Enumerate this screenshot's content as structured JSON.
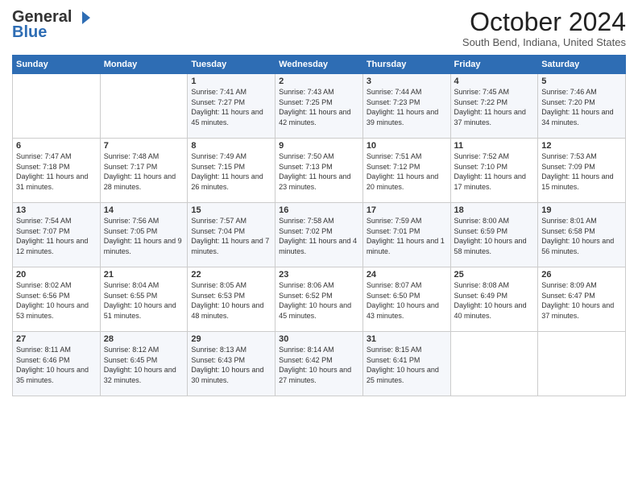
{
  "logo": {
    "line1": "General",
    "line2": "Blue",
    "icon": "▶"
  },
  "title": "October 2024",
  "location": "South Bend, Indiana, United States",
  "days_header": [
    "Sunday",
    "Monday",
    "Tuesday",
    "Wednesday",
    "Thursday",
    "Friday",
    "Saturday"
  ],
  "weeks": [
    [
      {
        "day": "",
        "sunrise": "",
        "sunset": "",
        "daylight": ""
      },
      {
        "day": "",
        "sunrise": "",
        "sunset": "",
        "daylight": ""
      },
      {
        "day": "1",
        "sunrise": "Sunrise: 7:41 AM",
        "sunset": "Sunset: 7:27 PM",
        "daylight": "Daylight: 11 hours and 45 minutes."
      },
      {
        "day": "2",
        "sunrise": "Sunrise: 7:43 AM",
        "sunset": "Sunset: 7:25 PM",
        "daylight": "Daylight: 11 hours and 42 minutes."
      },
      {
        "day": "3",
        "sunrise": "Sunrise: 7:44 AM",
        "sunset": "Sunset: 7:23 PM",
        "daylight": "Daylight: 11 hours and 39 minutes."
      },
      {
        "day": "4",
        "sunrise": "Sunrise: 7:45 AM",
        "sunset": "Sunset: 7:22 PM",
        "daylight": "Daylight: 11 hours and 37 minutes."
      },
      {
        "day": "5",
        "sunrise": "Sunrise: 7:46 AM",
        "sunset": "Sunset: 7:20 PM",
        "daylight": "Daylight: 11 hours and 34 minutes."
      }
    ],
    [
      {
        "day": "6",
        "sunrise": "Sunrise: 7:47 AM",
        "sunset": "Sunset: 7:18 PM",
        "daylight": "Daylight: 11 hours and 31 minutes."
      },
      {
        "day": "7",
        "sunrise": "Sunrise: 7:48 AM",
        "sunset": "Sunset: 7:17 PM",
        "daylight": "Daylight: 11 hours and 28 minutes."
      },
      {
        "day": "8",
        "sunrise": "Sunrise: 7:49 AM",
        "sunset": "Sunset: 7:15 PM",
        "daylight": "Daylight: 11 hours and 26 minutes."
      },
      {
        "day": "9",
        "sunrise": "Sunrise: 7:50 AM",
        "sunset": "Sunset: 7:13 PM",
        "daylight": "Daylight: 11 hours and 23 minutes."
      },
      {
        "day": "10",
        "sunrise": "Sunrise: 7:51 AM",
        "sunset": "Sunset: 7:12 PM",
        "daylight": "Daylight: 11 hours and 20 minutes."
      },
      {
        "day": "11",
        "sunrise": "Sunrise: 7:52 AM",
        "sunset": "Sunset: 7:10 PM",
        "daylight": "Daylight: 11 hours and 17 minutes."
      },
      {
        "day": "12",
        "sunrise": "Sunrise: 7:53 AM",
        "sunset": "Sunset: 7:09 PM",
        "daylight": "Daylight: 11 hours and 15 minutes."
      }
    ],
    [
      {
        "day": "13",
        "sunrise": "Sunrise: 7:54 AM",
        "sunset": "Sunset: 7:07 PM",
        "daylight": "Daylight: 11 hours and 12 minutes."
      },
      {
        "day": "14",
        "sunrise": "Sunrise: 7:56 AM",
        "sunset": "Sunset: 7:05 PM",
        "daylight": "Daylight: 11 hours and 9 minutes."
      },
      {
        "day": "15",
        "sunrise": "Sunrise: 7:57 AM",
        "sunset": "Sunset: 7:04 PM",
        "daylight": "Daylight: 11 hours and 7 minutes."
      },
      {
        "day": "16",
        "sunrise": "Sunrise: 7:58 AM",
        "sunset": "Sunset: 7:02 PM",
        "daylight": "Daylight: 11 hours and 4 minutes."
      },
      {
        "day": "17",
        "sunrise": "Sunrise: 7:59 AM",
        "sunset": "Sunset: 7:01 PM",
        "daylight": "Daylight: 11 hours and 1 minute."
      },
      {
        "day": "18",
        "sunrise": "Sunrise: 8:00 AM",
        "sunset": "Sunset: 6:59 PM",
        "daylight": "Daylight: 10 hours and 58 minutes."
      },
      {
        "day": "19",
        "sunrise": "Sunrise: 8:01 AM",
        "sunset": "Sunset: 6:58 PM",
        "daylight": "Daylight: 10 hours and 56 minutes."
      }
    ],
    [
      {
        "day": "20",
        "sunrise": "Sunrise: 8:02 AM",
        "sunset": "Sunset: 6:56 PM",
        "daylight": "Daylight: 10 hours and 53 minutes."
      },
      {
        "day": "21",
        "sunrise": "Sunrise: 8:04 AM",
        "sunset": "Sunset: 6:55 PM",
        "daylight": "Daylight: 10 hours and 51 minutes."
      },
      {
        "day": "22",
        "sunrise": "Sunrise: 8:05 AM",
        "sunset": "Sunset: 6:53 PM",
        "daylight": "Daylight: 10 hours and 48 minutes."
      },
      {
        "day": "23",
        "sunrise": "Sunrise: 8:06 AM",
        "sunset": "Sunset: 6:52 PM",
        "daylight": "Daylight: 10 hours and 45 minutes."
      },
      {
        "day": "24",
        "sunrise": "Sunrise: 8:07 AM",
        "sunset": "Sunset: 6:50 PM",
        "daylight": "Daylight: 10 hours and 43 minutes."
      },
      {
        "day": "25",
        "sunrise": "Sunrise: 8:08 AM",
        "sunset": "Sunset: 6:49 PM",
        "daylight": "Daylight: 10 hours and 40 minutes."
      },
      {
        "day": "26",
        "sunrise": "Sunrise: 8:09 AM",
        "sunset": "Sunset: 6:47 PM",
        "daylight": "Daylight: 10 hours and 37 minutes."
      }
    ],
    [
      {
        "day": "27",
        "sunrise": "Sunrise: 8:11 AM",
        "sunset": "Sunset: 6:46 PM",
        "daylight": "Daylight: 10 hours and 35 minutes."
      },
      {
        "day": "28",
        "sunrise": "Sunrise: 8:12 AM",
        "sunset": "Sunset: 6:45 PM",
        "daylight": "Daylight: 10 hours and 32 minutes."
      },
      {
        "day": "29",
        "sunrise": "Sunrise: 8:13 AM",
        "sunset": "Sunset: 6:43 PM",
        "daylight": "Daylight: 10 hours and 30 minutes."
      },
      {
        "day": "30",
        "sunrise": "Sunrise: 8:14 AM",
        "sunset": "Sunset: 6:42 PM",
        "daylight": "Daylight: 10 hours and 27 minutes."
      },
      {
        "day": "31",
        "sunrise": "Sunrise: 8:15 AM",
        "sunset": "Sunset: 6:41 PM",
        "daylight": "Daylight: 10 hours and 25 minutes."
      },
      {
        "day": "",
        "sunrise": "",
        "sunset": "",
        "daylight": ""
      },
      {
        "day": "",
        "sunrise": "",
        "sunset": "",
        "daylight": ""
      }
    ]
  ]
}
